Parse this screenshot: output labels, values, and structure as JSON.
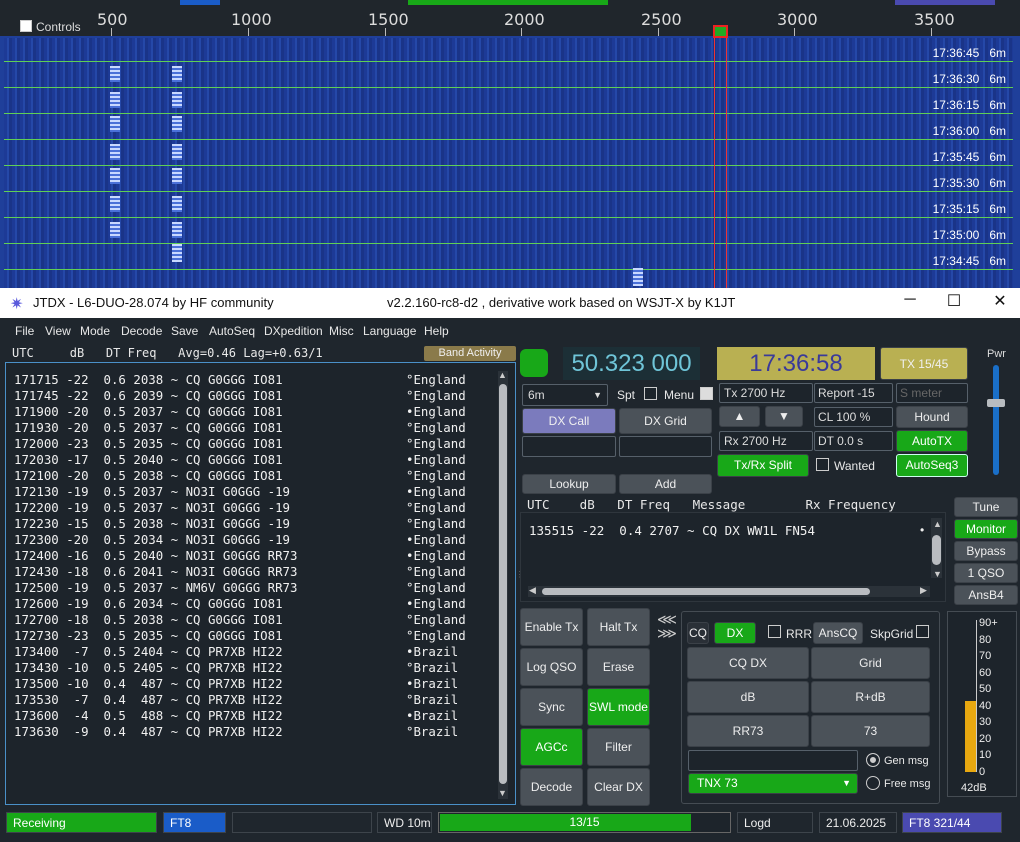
{
  "waterfall": {
    "controls_label": "Controls",
    "scale_labels": [
      "500",
      "1000",
      "1500",
      "2000",
      "2500",
      "3000",
      "3500"
    ],
    "timestamps": [
      {
        "time": "17:36:45",
        "band": "6m"
      },
      {
        "time": "17:36:30",
        "band": "6m"
      },
      {
        "time": "17:36:15",
        "band": "6m"
      },
      {
        "time": "17:36:00",
        "band": "6m"
      },
      {
        "time": "17:35:45",
        "band": "6m"
      },
      {
        "time": "17:35:30",
        "band": "6m"
      },
      {
        "time": "17:35:15",
        "band": "6m"
      },
      {
        "time": "17:35:00",
        "band": "6m"
      },
      {
        "time": "17:34:45",
        "band": "6m"
      }
    ]
  },
  "titlebar": {
    "icon": "star-icon",
    "title": "JTDX - L6-DUO-28.074  by HF community",
    "subtitle": "v2.2.160-rc8-d2 , derivative work based on WSJT-X by K1JT",
    "minimize": "─",
    "maximize": "☐",
    "close": "✕"
  },
  "menu": [
    "File",
    "View",
    "Mode",
    "Decode",
    "Save",
    "AutoSeq",
    "DXpedition",
    "Misc",
    "Language",
    "Help"
  ],
  "left_pane": {
    "header": "UTC     dB   DT Freq   Avg=0.46 Lag=+0.63/1",
    "band_activity": "Band Activity",
    "decodes": [
      {
        "text": "171715 -22  0.6 2038 ~ CQ G0GGG IO81",
        "country": "°England"
      },
      {
        "text": "171745 -22  0.6 2039 ~ CQ G0GGG IO81",
        "country": "°England"
      },
      {
        "text": "171900 -20  0.5 2037 ~ CQ G0GGG IO81",
        "country": "•England"
      },
      {
        "text": "171930 -20  0.5 2037 ~ CQ G0GGG IO81",
        "country": "°England"
      },
      {
        "text": "172000 -23  0.5 2035 ~ CQ G0GGG IO81",
        "country": "°England"
      },
      {
        "text": "172030 -17  0.5 2040 ~ CQ G0GGG IO81",
        "country": "•England"
      },
      {
        "text": "172100 -20  0.5 2038 ~ CQ G0GGG IO81",
        "country": "°England"
      },
      {
        "text": "172130 -19  0.5 2037 ~ NO3I G0GGG -19",
        "country": "•England"
      },
      {
        "text": "172200 -19  0.5 2037 ~ NO3I G0GGG -19",
        "country": "°England"
      },
      {
        "text": "172230 -15  0.5 2038 ~ NO3I G0GGG -19",
        "country": "°England"
      },
      {
        "text": "172300 -20  0.5 2034 ~ NO3I G0GGG -19",
        "country": "•England"
      },
      {
        "text": "172400 -16  0.5 2040 ~ NO3I G0GGG RR73",
        "country": "•England"
      },
      {
        "text": "172430 -18  0.6 2041 ~ NO3I G0GGG RR73",
        "country": "°England"
      },
      {
        "text": "172500 -19  0.5 2037 ~ NM6V G0GGG RR73",
        "country": "°England"
      },
      {
        "text": "172600 -19  0.6 2034 ~ CQ G0GGG IO81",
        "country": "•England"
      },
      {
        "text": "172700 -18  0.5 2038 ~ CQ G0GGG IO81",
        "country": "°England"
      },
      {
        "text": "172730 -23  0.5 2035 ~ CQ G0GGG IO81",
        "country": "°England"
      },
      {
        "text": "173400  -7  0.5 2404 ~ CQ PR7XB HI22",
        "country": "•Brazil"
      },
      {
        "text": "173430 -10  0.5 2405 ~ CQ PR7XB HI22",
        "country": "°Brazil"
      },
      {
        "text": "173500 -10  0.4  487 ~ CQ PR7XB HI22",
        "country": "•Brazil"
      },
      {
        "text": "173530  -7  0.4  487 ~ CQ PR7XB HI22",
        "country": "°Brazil"
      },
      {
        "text": "173600  -4  0.5  488 ~ CQ PR7XB HI22",
        "country": "•Brazil"
      },
      {
        "text": "173630  -9  0.4  487 ~ CQ PR7XB HI22",
        "country": "°Brazil"
      }
    ]
  },
  "controls": {
    "frequency": "50.323 000",
    "clock": "17:36:58",
    "tx_counter": "TX 15/45",
    "pwr_label": "Pwr",
    "band": "6m",
    "spt": "Spt",
    "menu": "Menu",
    "tx_freq": "Tx  2700  Hz",
    "rx_freq": "Rx  2700  Hz",
    "report": "Report -15",
    "s_meter": "S meter",
    "cl": "CL  100 %",
    "dt": "DT 0.0 s",
    "hound": "Hound",
    "autotx": "AutoTX",
    "autoseq3": "AutoSeq3",
    "dx_call": "DX Call",
    "dx_grid": "DX Grid",
    "txrx_split": "Tx/Rx Split",
    "wanted": "Wanted",
    "lookup": "Lookup",
    "add": "Add",
    "up_arrow": "▲",
    "down_arrow": "▼"
  },
  "rx_pane": {
    "header": "UTC    dB   DT Freq   Message        Rx Frequency",
    "line": "135515 -22  0.4 2707 ~ CQ DX WW1L FN54",
    "dot": "•"
  },
  "right_buttons": [
    "Tune",
    "Monitor",
    "Bypass",
    "1 QSO",
    "AnsB4"
  ],
  "bottom_buttons": {
    "enable_tx": "Enable Tx",
    "halt_tx": "Halt Tx",
    "log_qso": "Log QSO",
    "erase": "Erase",
    "sync": "Sync",
    "swl_mode": "SWL mode",
    "agcc": "AGCc",
    "filter": "Filter",
    "decode": "Decode",
    "clear_dx": "Clear DX"
  },
  "msg_panel": {
    "cq": "CQ",
    "dx": "DX",
    "rrr": "RRR",
    "anscq": "AnsCQ",
    "skpgrid": "SkpGrid",
    "cq_dx": "CQ DX",
    "grid": "Grid",
    "db": "dB",
    "r_db": "R+dB",
    "rr73": "RR73",
    "73": "73",
    "gen_msg": "Gen msg",
    "free_msg": "Free msg",
    "free_text": "TNX 73"
  },
  "meter": {
    "labels": [
      "90+",
      "80",
      "70",
      "60",
      "50",
      "40",
      "30",
      "20",
      "10",
      "0"
    ],
    "level_db": 42,
    "db_label": "42dB"
  },
  "status": {
    "receiving": "Receiving",
    "mode": "FT8",
    "wd": "WD 10m",
    "progress_label": "13/15",
    "progress_value": 0.867,
    "logd": "Logd",
    "date": "21.06.2025",
    "mode_count": "FT8  321/44"
  }
}
